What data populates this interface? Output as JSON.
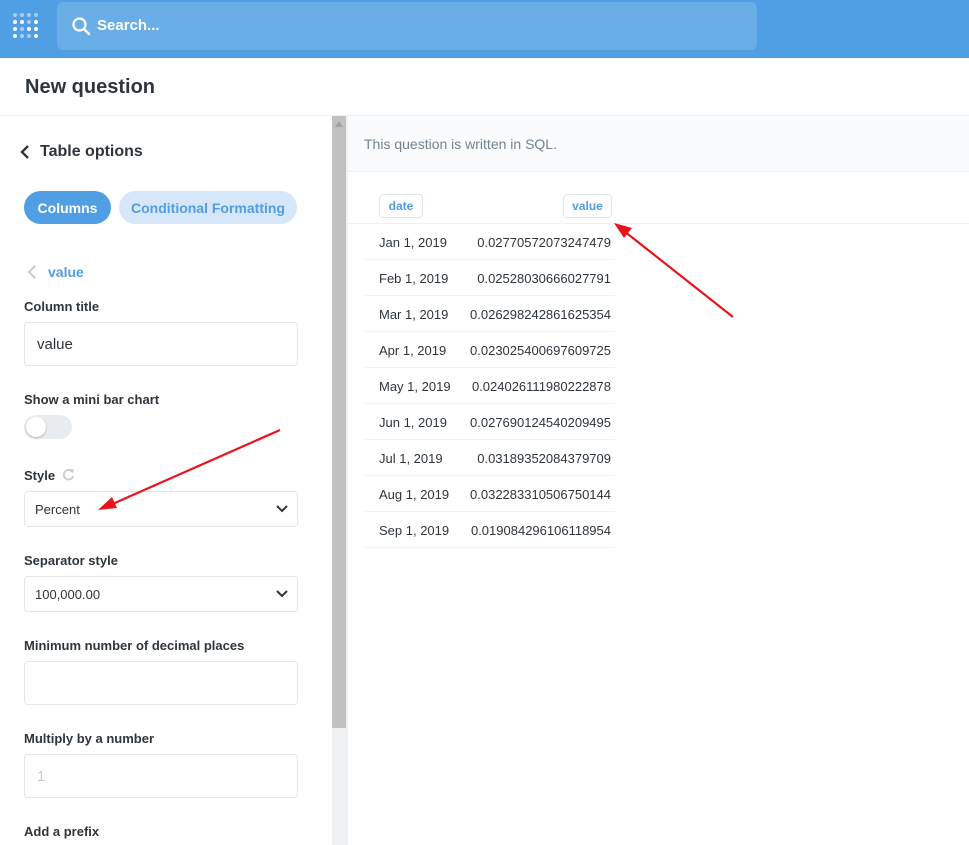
{
  "search": {
    "placeholder": "Search..."
  },
  "header": {
    "title": "New question"
  },
  "sidebar": {
    "back_label": "Table options",
    "tabs": [
      "Columns",
      "Conditional Formatting"
    ],
    "column_back_label": "value",
    "column_title_label": "Column title",
    "column_title_value": "value",
    "mini_bar_label": "Show a mini bar chart",
    "mini_bar_enabled": false,
    "style_label": "Style",
    "style_value": "Percent",
    "separator_label": "Separator style",
    "separator_value": "100,000.00",
    "min_decimals_label": "Minimum number of decimal places",
    "min_decimals_value": "",
    "multiply_label": "Multiply by a number",
    "multiply_placeholder": "1",
    "prefix_label": "Add a prefix"
  },
  "main": {
    "sql_notice": "This question is written in SQL.",
    "columns": [
      "date",
      "value"
    ],
    "rows": [
      {
        "date": "Jan 1, 2019",
        "value": "0.02770572073247479"
      },
      {
        "date": "Feb 1, 2019",
        "value": "0.02528030666027791"
      },
      {
        "date": "Mar 1, 2019",
        "value": "0.026298242861625354"
      },
      {
        "date": "Apr 1, 2019",
        "value": "0.023025400697609725"
      },
      {
        "date": "May 1, 2019",
        "value": "0.024026111980222878"
      },
      {
        "date": "Jun 1, 2019",
        "value": "0.027690124540209495"
      },
      {
        "date": "Jul 1, 2019",
        "value": "0.03189352084379709"
      },
      {
        "date": "Aug 1, 2019",
        "value": "0.032283310506750144"
      },
      {
        "date": "Sep 1, 2019",
        "value": "0.019084296106118954"
      }
    ]
  },
  "colors": {
    "brand": "#509ee3",
    "annotation": "#e8141b"
  }
}
